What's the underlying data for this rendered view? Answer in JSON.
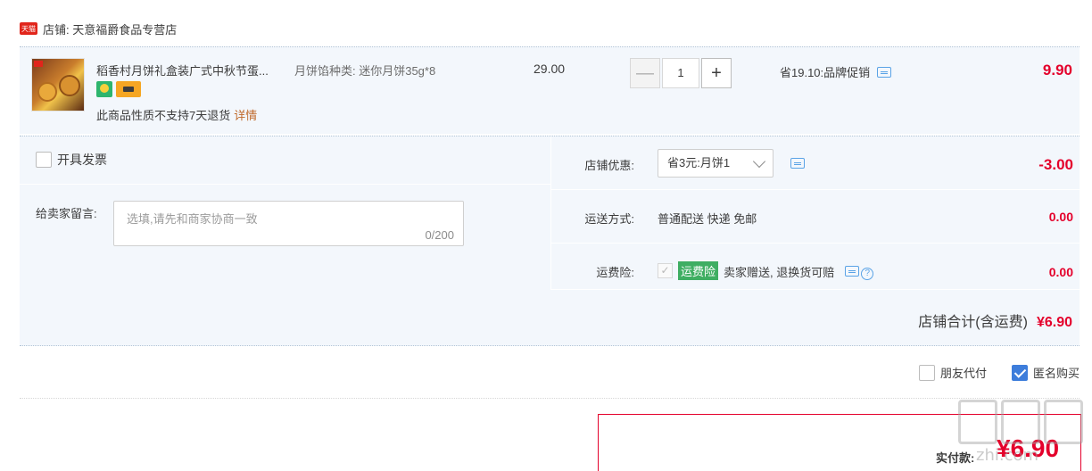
{
  "store": {
    "badge": "天猫",
    "label": "店铺: 天意福爵食品专营店"
  },
  "item": {
    "title": "稻香村月饼礼盒装广式中秋节蛋...",
    "sku": "月饼馅种类: 迷你月饼35g*8",
    "return_note": "此商品性质不支持7天退货",
    "details_link": "详情",
    "unit_price": "29.00",
    "qty_minus": "—",
    "qty_value": "1",
    "qty_plus": "+",
    "promo": "省19.10:品牌促销",
    "total": "9.90"
  },
  "order": {
    "invoice_label": "开具发票",
    "message_label": "给卖家留言:",
    "message_placeholder": "选填,请先和商家协商一致",
    "message_count": "0/200",
    "discount_label": "店铺优惠:",
    "discount_select": "省3元:月饼1",
    "discount_amount": "-3.00",
    "shipping_label": "运送方式:",
    "shipping_method": "普通配送 快递 免邮",
    "shipping_amount": "0.00",
    "insurance_label": "运费险:",
    "insurance_tag": "运费险",
    "insurance_text": "卖家赠送, 退换货可赔",
    "insurance_amount": "0.00",
    "store_total_label": "店铺合计(含运费)",
    "store_total_value": "¥6.90"
  },
  "extras": {
    "friend_pay": "朋友代付",
    "anonymous": "匿名购买"
  },
  "payment": {
    "label": "实付款:",
    "amount": "¥6.90"
  },
  "watermark": {
    "text": "zhi.com"
  },
  "colors": {
    "price_red": "#e4002b",
    "block_bg": "#f3f7fc",
    "check_blue": "#3d7ddb",
    "insurance_green": "#3fae62"
  }
}
